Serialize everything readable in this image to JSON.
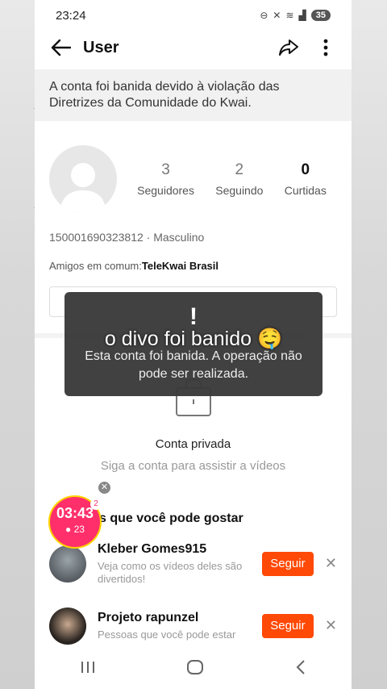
{
  "status": {
    "time": "23:24",
    "battery": "35"
  },
  "appbar": {
    "title": "User"
  },
  "banner": {
    "text": "A conta foi banida devido à violação das Diretrizes da Comunidade do Kwai."
  },
  "profile": {
    "stats": [
      {
        "value": "3",
        "label": "Seguidores"
      },
      {
        "value": "2",
        "label": "Seguindo"
      },
      {
        "value": "0",
        "label": "Curtidas"
      }
    ],
    "id_line": "150001690323812 · Masculino",
    "friends_prefix": "Amigos em comum:",
    "friends_name": "TeleKwai Brasil"
  },
  "private": {
    "title": "Conta privada",
    "subtitle": "Siga a conta para assistir a vídeos"
  },
  "recommend": {
    "title": "Contas que você pode gostar",
    "title_visible": "s que você pode gostar",
    "items": [
      {
        "name": "Kleber Gomes915",
        "sub": "Veja como os vídeos deles são divertidos!",
        "button": "Seguir"
      },
      {
        "name": "Projeto rapunzel",
        "sub": "Pessoas que você pode estar interessado",
        "sub_visible": "Pessoas que você pode estar",
        "button": "Seguir"
      }
    ]
  },
  "toast": {
    "bang": "!",
    "caption": "o divo foi banido 🤤",
    "message": "Esta conta foi banida. A operação não pode ser realizada."
  },
  "timer": {
    "time": "03:43",
    "coins": "23",
    "badge": "2"
  }
}
